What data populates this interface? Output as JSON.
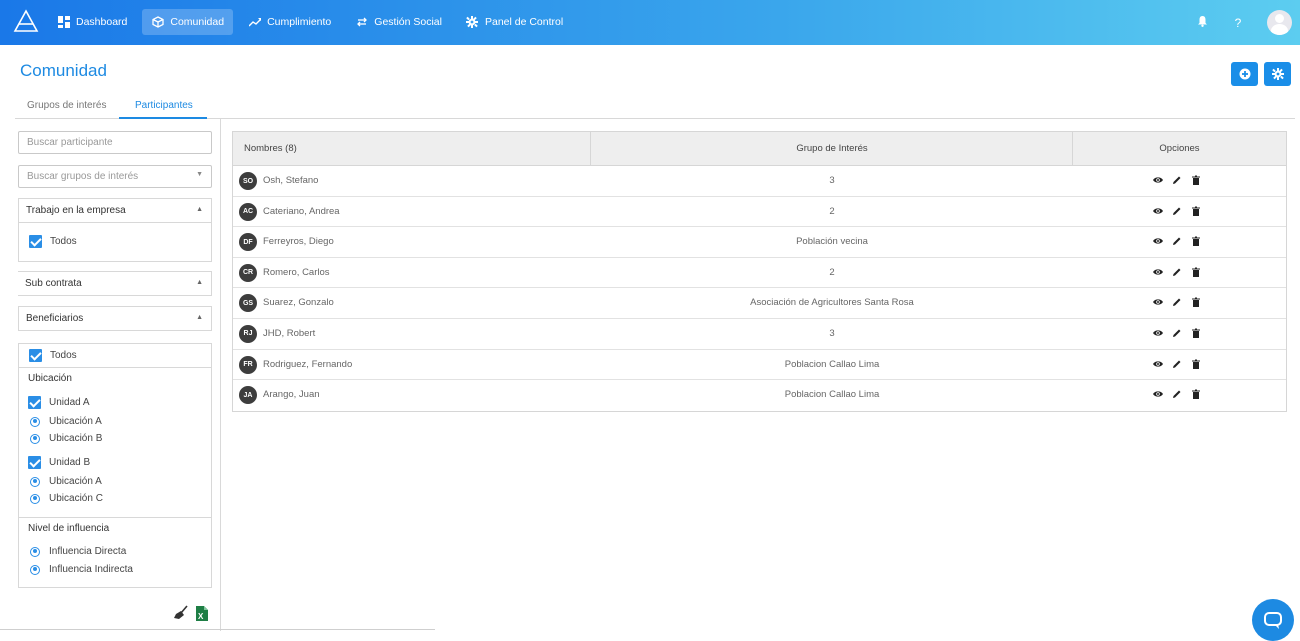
{
  "topbar": {
    "nav": [
      {
        "label": "Dashboard",
        "icon": "dashboard-icon"
      },
      {
        "label": "Comunidad",
        "icon": "cube-icon",
        "active": true
      },
      {
        "label": "Cumplimiento",
        "icon": "trend-icon"
      },
      {
        "label": "Gestión Social",
        "icon": "swap-icon"
      },
      {
        "label": "Panel de Control",
        "icon": "gear-icon"
      }
    ],
    "help": "?",
    "colors": {
      "start": "#1a78e8",
      "end": "#5ccdf0"
    }
  },
  "page": {
    "title": "Comunidad"
  },
  "tabs": [
    {
      "label": "Grupos de interés",
      "active": false
    },
    {
      "label": "Participantes",
      "active": true
    }
  ],
  "filters": {
    "search_participant_placeholder": "Buscar participante",
    "search_group_placeholder": "Buscar grupos de interés",
    "trabajo": {
      "title": "Trabajo en la empresa",
      "todos": "Todos"
    },
    "subcontrata": {
      "title": "Sub contrata"
    },
    "beneficiarios": {
      "title": "Beneficiarios",
      "todos": "Todos"
    },
    "ubicacion": {
      "title": "Ubicación",
      "unidad_a": "Unidad A",
      "unidad_a_items": [
        "Ubicación A",
        "Ubicación B"
      ],
      "unidad_b": "Unidad B",
      "unidad_b_items": [
        "Ubicación A",
        "Ubicación C"
      ]
    },
    "influencia": {
      "title": "Nivel de influencia",
      "items": [
        "Influencia Directa",
        "Influencia Indirecta"
      ]
    }
  },
  "table": {
    "headers": {
      "names": "Nombres (8)",
      "group": "Grupo de Interés",
      "options": "Opciones"
    },
    "rows": [
      {
        "initials": "SO",
        "name": "Osh, Stefano",
        "group": "3"
      },
      {
        "initials": "AC",
        "name": "Cateriano, Andrea",
        "group": "2"
      },
      {
        "initials": "DF",
        "name": "Ferreyros, Diego",
        "group": "Población vecina"
      },
      {
        "initials": "CR",
        "name": "Romero, Carlos",
        "group": "2"
      },
      {
        "initials": "GS",
        "name": "Suarez, Gonzalo",
        "group": "Asociación de Agricultores Santa Rosa"
      },
      {
        "initials": "RJ",
        "name": "JHD, Robert",
        "group": "3"
      },
      {
        "initials": "FR",
        "name": "Rodriguez, Fernando",
        "group": "Poblacion Callao Lima"
      },
      {
        "initials": "JA",
        "name": "Arango, Juan",
        "group": "Poblacion Callao Lima"
      }
    ]
  },
  "accent_color": "#1d8ae2"
}
